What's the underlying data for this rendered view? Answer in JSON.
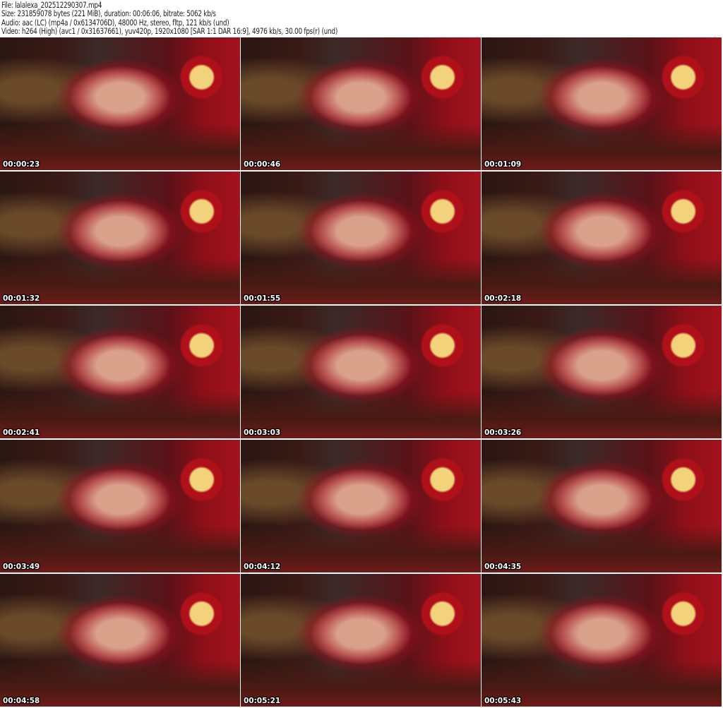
{
  "header": {
    "file": "File: lalalexa_202512290307.mp4",
    "size": "Size: 231859078 bytes (221 MiB), duration: 00:06:06, bitrate: 5062 kb/s",
    "audio": "Audio: aac (LC) (mp4a / 0x6134706D), 48000 Hz, stereo, fltp, 121 kb/s (und)",
    "video": "Video: h264 (High) (avc1 / 0x31637661), yuv420p, 1920x1080 [SAR 1:1 DAR 16:9], 4976 kb/s, 30.00 fps(r) (und)"
  },
  "thumbnails": [
    {
      "timestamp": "00:00:23"
    },
    {
      "timestamp": "00:00:46"
    },
    {
      "timestamp": "00:01:09"
    },
    {
      "timestamp": "00:01:32"
    },
    {
      "timestamp": "00:01:55"
    },
    {
      "timestamp": "00:02:18"
    },
    {
      "timestamp": "00:02:41"
    },
    {
      "timestamp": "00:03:03"
    },
    {
      "timestamp": "00:03:26"
    },
    {
      "timestamp": "00:03:49"
    },
    {
      "timestamp": "00:04:12"
    },
    {
      "timestamp": "00:04:35"
    },
    {
      "timestamp": "00:04:58"
    },
    {
      "timestamp": "00:05:21"
    },
    {
      "timestamp": "00:05:43"
    }
  ]
}
